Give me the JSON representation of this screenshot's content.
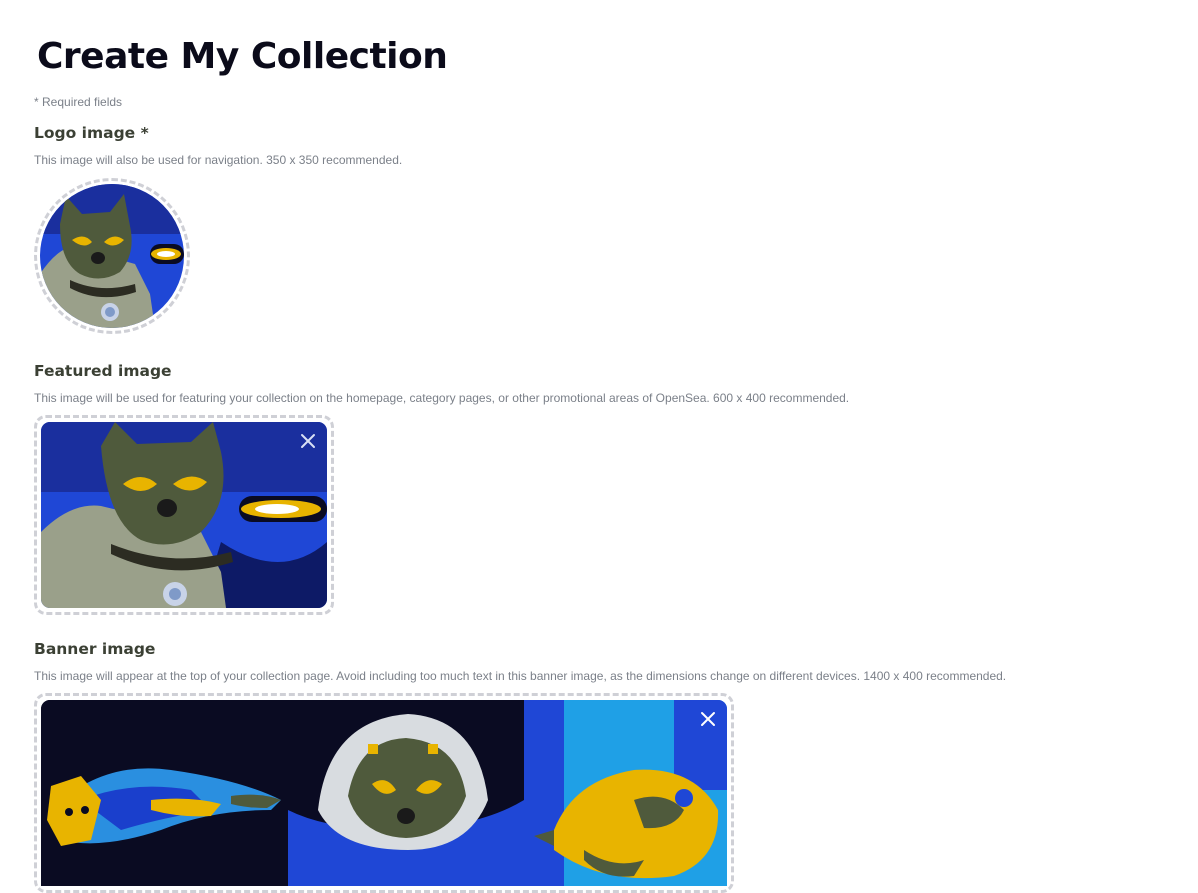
{
  "page": {
    "title": "Create My Collection",
    "required_note": "* Required fields"
  },
  "logo": {
    "label": "Logo image *",
    "description": "This image will also be used for navigation. 350 x 350 recommended.",
    "image_icon": "cat-portrait-image"
  },
  "featured": {
    "label": "Featured image",
    "description": "This image will be used for featuring your collection on the homepage, category pages, or other promotional areas of OpenSea. 600 x 400 recommended.",
    "image_icon": "cat-portrait-image",
    "close_icon": "close-icon"
  },
  "banner": {
    "label": "Banner image",
    "description": "This image will appear at the top of your collection page. Avoid including too much text in this banner image, as the dimensions change on different devices. 1400 x 400 recommended.",
    "panels": [
      "lying-cat-image",
      "kitten-portrait-image",
      "yellow-creature-image"
    ],
    "close_icon": "close-icon"
  },
  "colors": {
    "title": "#0b0b1a",
    "label": "#3b4034",
    "muted": "#7b8089",
    "dashed_border": "#cfd0d6",
    "art_blue": "#1f47d6",
    "art_yellow": "#e8b400",
    "art_dark": "#0a0b22"
  }
}
